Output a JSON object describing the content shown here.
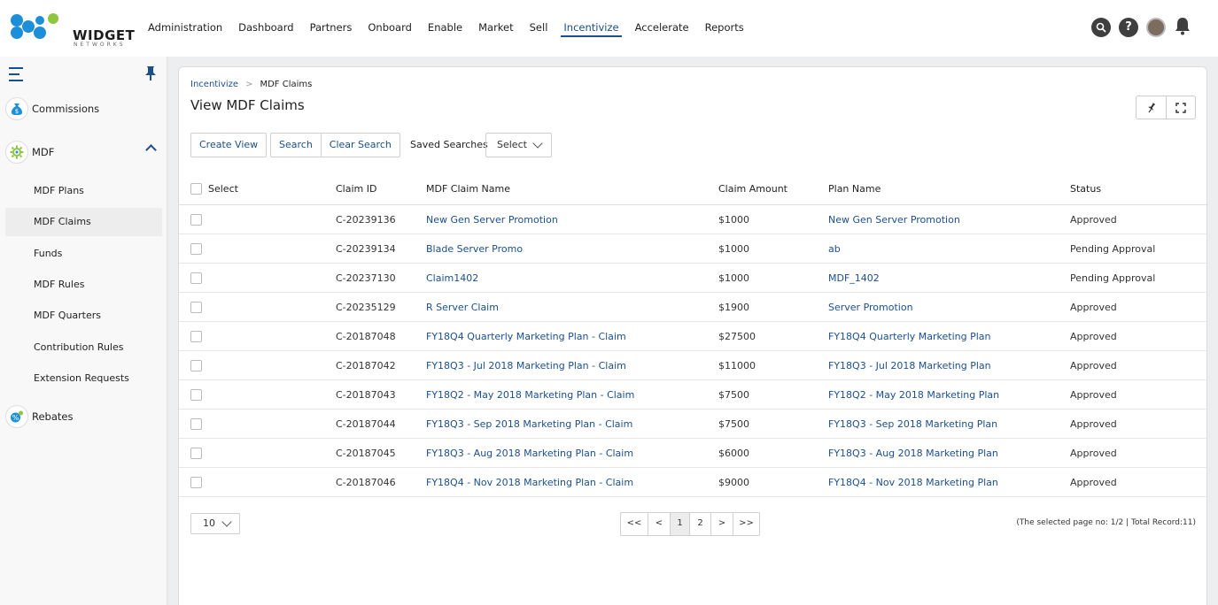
{
  "brand": {
    "name": "WIDGET",
    "sub": "NETWORKS"
  },
  "nav": {
    "items": [
      "Administration",
      "Dashboard",
      "Partners",
      "Onboard",
      "Enable",
      "Market",
      "Sell",
      "Incentivize",
      "Accelerate",
      "Reports"
    ],
    "active": "Incentivize"
  },
  "top_icons": [
    "search-icon",
    "help-icon",
    "avatar",
    "bell-icon"
  ],
  "sidebar": {
    "sections": [
      {
        "label": "Commissions",
        "icon": "money-bag-icon"
      },
      {
        "label": "MDF",
        "icon": "gear-flower-icon"
      },
      {
        "label": "Rebates",
        "icon": "percent-icon"
      }
    ],
    "mdf_items": [
      "MDF Plans",
      "MDF Claims",
      "Funds",
      "MDF Rules",
      "MDF Quarters",
      "Contribution Rules",
      "Extension Requests"
    ],
    "active_item": "MDF Claims"
  },
  "breadcrumb": {
    "parent": "Incentivize",
    "current": "MDF Claims"
  },
  "page_title": "View MDF Claims",
  "toolbar": {
    "create_view": "Create View",
    "search": "Search",
    "clear_search": "Clear Search",
    "saved_searches_label": "Saved Searches",
    "saved_searches_value": "Select"
  },
  "table": {
    "headers": {
      "select": "Select",
      "claim_id": "Claim ID",
      "claim_name": "MDF Claim Name",
      "amount": "Claim Amount",
      "plan": "Plan Name",
      "status": "Status"
    },
    "rows": [
      {
        "claim_id": "C-20239136",
        "claim_name": "New Gen Server Promotion",
        "amount": "$1000",
        "plan": "New Gen Server Promotion",
        "status": "Approved"
      },
      {
        "claim_id": "C-20239134",
        "claim_name": "Blade Server Promo",
        "amount": "$1000",
        "plan": "ab",
        "status": "Pending Approval"
      },
      {
        "claim_id": "C-20237130",
        "claim_name": "Claim1402",
        "amount": "$1000",
        "plan": "MDF_1402",
        "status": "Pending Approval"
      },
      {
        "claim_id": "C-20235129",
        "claim_name": "R Server Claim",
        "amount": "$1900",
        "plan": "Server Promotion",
        "status": "Approved"
      },
      {
        "claim_id": "C-20187048",
        "claim_name": "FY18Q4 Quarterly Marketing Plan - Claim",
        "amount": "$27500",
        "plan": "FY18Q4 Quarterly Marketing Plan",
        "status": "Approved"
      },
      {
        "claim_id": "C-20187042",
        "claim_name": "FY18Q3 - Jul 2018 Marketing Plan - Claim",
        "amount": "$11000",
        "plan": "FY18Q3 - Jul 2018 Marketing Plan",
        "status": "Approved"
      },
      {
        "claim_id": "C-20187043",
        "claim_name": "FY18Q2 - May 2018 Marketing Plan - Claim",
        "amount": "$7500",
        "plan": "FY18Q2 - May 2018 Marketing Plan",
        "status": "Approved"
      },
      {
        "claim_id": "C-20187044",
        "claim_name": "FY18Q3 - Sep 2018 Marketing Plan - Claim",
        "amount": "$7500",
        "plan": "FY18Q3 - Sep 2018 Marketing Plan",
        "status": "Approved"
      },
      {
        "claim_id": "C-20187045",
        "claim_name": "FY18Q3 - Aug 2018 Marketing Plan - Claim",
        "amount": "$6000",
        "plan": "FY18Q3 - Aug 2018 Marketing Plan",
        "status": "Approved"
      },
      {
        "claim_id": "C-20187046",
        "claim_name": "FY18Q4 - Nov 2018 Marketing Plan - Claim",
        "amount": "$9000",
        "plan": "FY18Q4 - Nov 2018 Marketing Plan",
        "status": "Approved"
      }
    ]
  },
  "pagination": {
    "page_size": "10",
    "buttons": [
      "<<",
      "<",
      "1",
      "2",
      ">",
      ">>"
    ],
    "current": "1",
    "info": "(The selected page no: 1/2 | Total Record:11)"
  },
  "colors": {
    "accent": "#1b4f8e",
    "logo_blue": "#1d8fd8",
    "logo_green": "#8dc63f"
  }
}
